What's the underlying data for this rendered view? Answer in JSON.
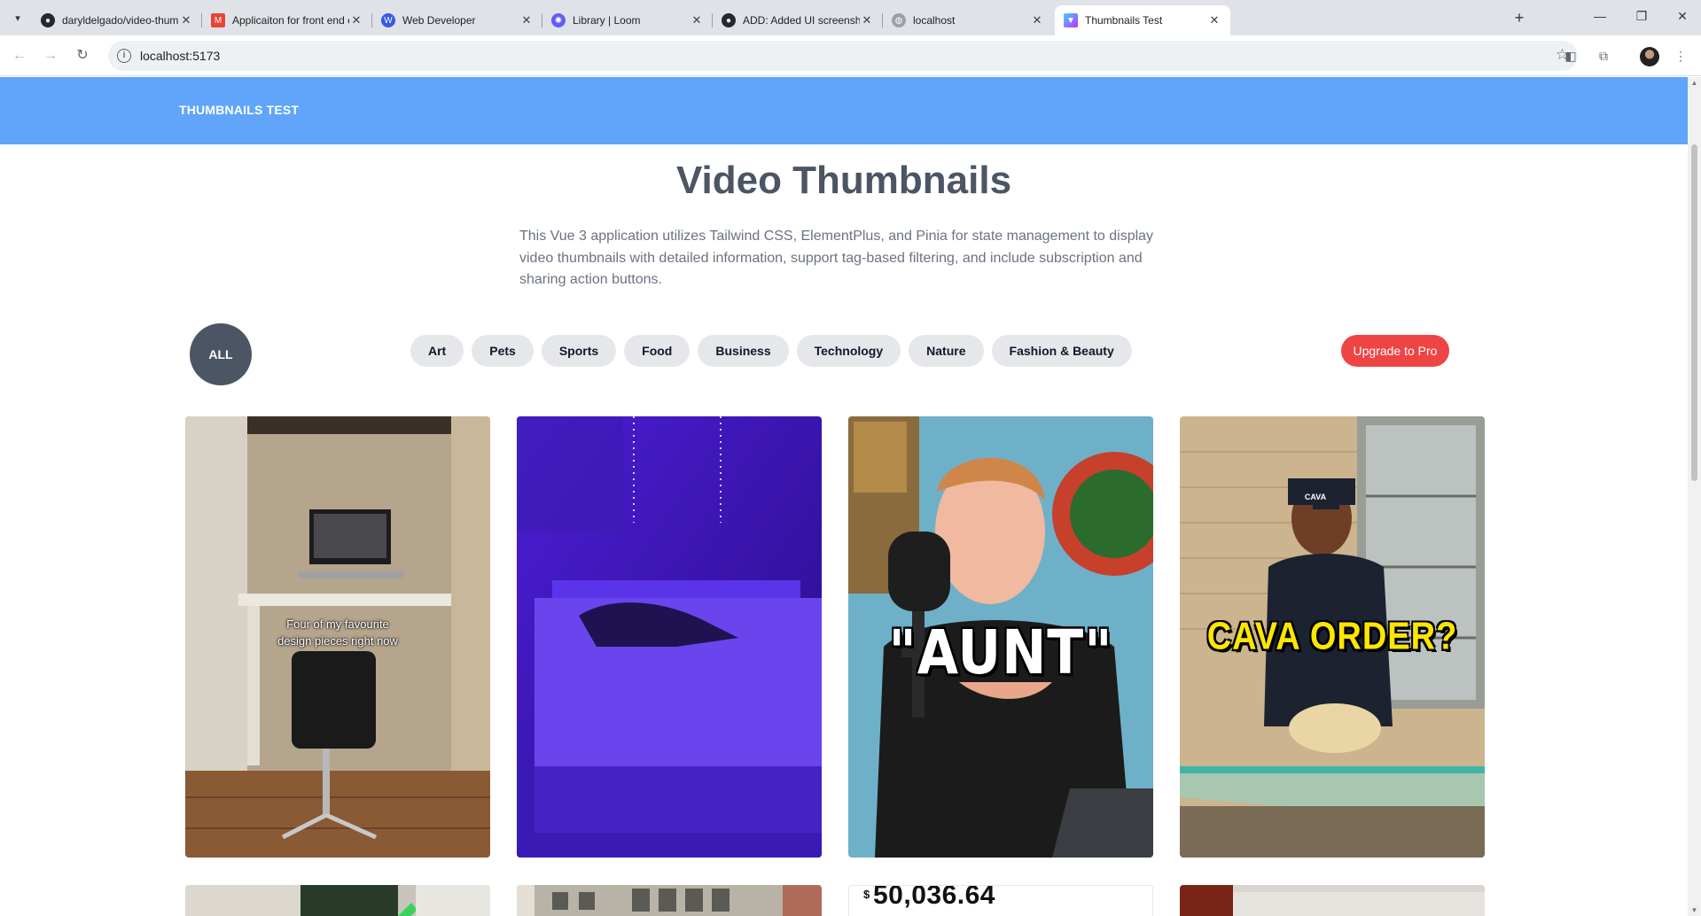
{
  "browser": {
    "tabs": [
      {
        "title": "daryldelgado/video-thumbnails",
        "icon": "github-icon"
      },
      {
        "title": "Applicaiton for front end engin",
        "icon": "gmail-icon"
      },
      {
        "title": "Web Developer",
        "icon": "wordpress-icon"
      },
      {
        "title": "Library | Loom",
        "icon": "loom-icon"
      },
      {
        "title": "ADD: Added UI screenshot in re",
        "icon": "github-icon"
      },
      {
        "title": "localhost",
        "icon": "globe-icon"
      },
      {
        "title": "Thumbnails Test",
        "icon": "vite-icon"
      }
    ],
    "url": "localhost:5173"
  },
  "header": {
    "brand": "THUMBNAILS TEST"
  },
  "main": {
    "title": "Video Thumbnails",
    "description": "This Vue 3 application utilizes Tailwind CSS, ElementPlus, and Pinia for state management to display video thumbnails with detailed information, support tag-based filtering, and include subscription and sharing action buttons."
  },
  "filters": {
    "all_label": "ALL",
    "tags": [
      "Art",
      "Pets",
      "Sports",
      "Food",
      "Business",
      "Technology",
      "Nature",
      "Fashion & Beauty"
    ],
    "upgrade_label": "Upgrade to Pro"
  },
  "thumbnails": [
    {
      "caption_line1": "Four of my favourite",
      "caption_line2": "design pieces right now"
    },
    {
      "caption": ""
    },
    {
      "caption": "\"AUNT\""
    },
    {
      "caption": "CAVA ORDER?",
      "cap_text": "CAVA"
    },
    {
      "caption": ""
    },
    {
      "caption": ""
    },
    {
      "amount_symbol": "$",
      "amount": "50,036.64"
    },
    {
      "caption": ""
    }
  ],
  "colors": {
    "header_bg": "#60a5fa",
    "all_button_bg": "#4b5563",
    "tag_bg": "#e5e7eb",
    "upgrade_bg": "#ef4444"
  }
}
